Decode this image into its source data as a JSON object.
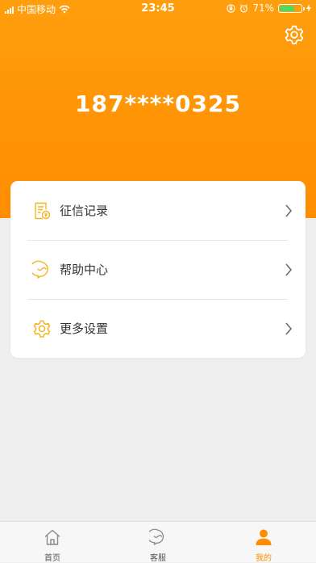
{
  "status_bar": {
    "carrier": "中国移动",
    "time": "23:45",
    "battery_text": "71%",
    "battery_level": 0.71
  },
  "header": {
    "phone_masked": "187****0325",
    "settings_icon": "gear-icon"
  },
  "menu": {
    "items": [
      {
        "label": "征信记录",
        "icon": "credit-report-icon"
      },
      {
        "label": "帮助中心",
        "icon": "help-chat-icon"
      },
      {
        "label": "更多设置",
        "icon": "settings-gear-icon"
      }
    ]
  },
  "tabbar": {
    "tabs": [
      {
        "label": "首页",
        "icon": "home-icon",
        "active": false
      },
      {
        "label": "客服",
        "icon": "customer-service-icon",
        "active": false
      },
      {
        "label": "我的",
        "icon": "user-icon",
        "active": true
      }
    ]
  },
  "colors": {
    "accent": "#ff8d00",
    "icon_yellow": "#f5b31b",
    "background": "#efefef"
  }
}
